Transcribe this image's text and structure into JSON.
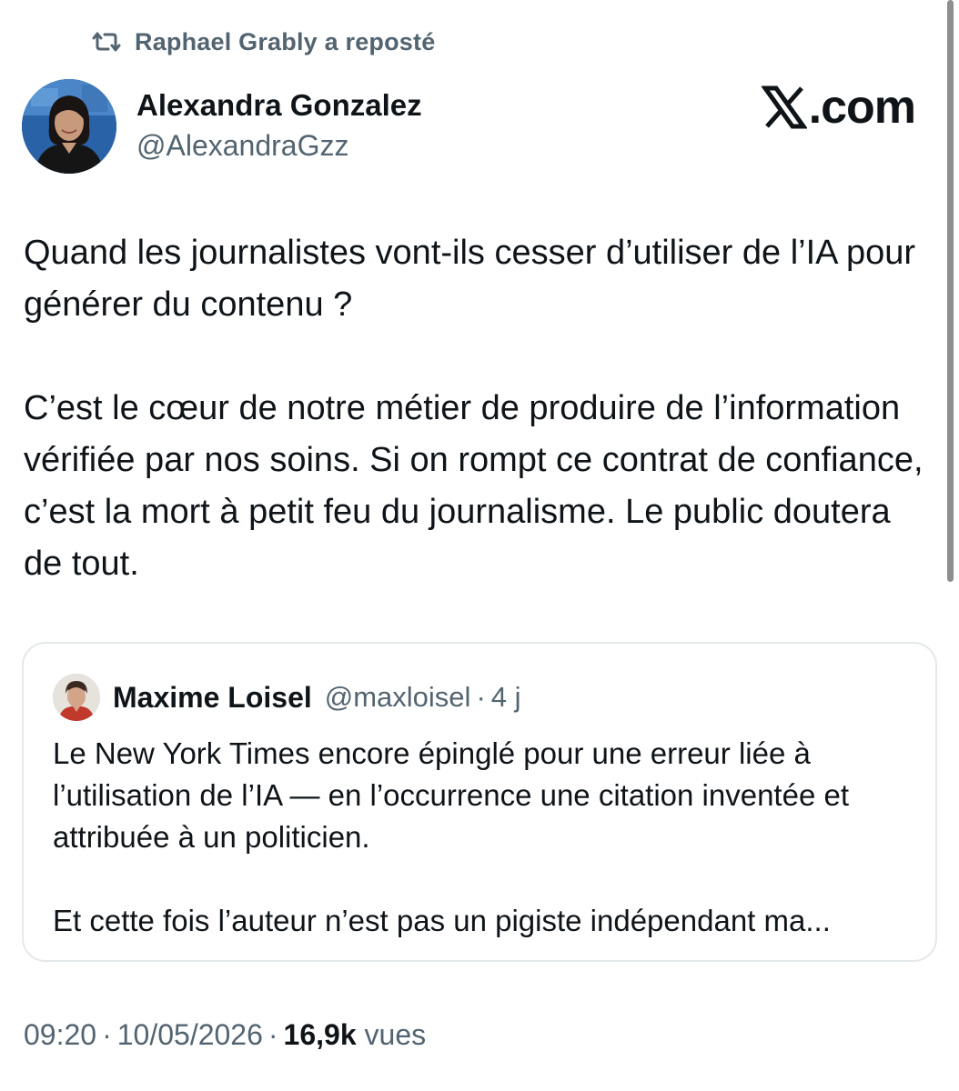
{
  "repost": {
    "icon": "repost-icon",
    "text": "Raphael Grably a reposté"
  },
  "author": {
    "name": "Alexandra Gonzalez",
    "handle": "@AlexandraGzz",
    "avatar": "author-avatar-photo"
  },
  "site_mark": {
    "logo": "x-logo-icon",
    "suffix": ".com"
  },
  "tweet": {
    "paragraphs": [
      "Quand les journalistes vont-ils cesser d’utiliser de l’IA pour générer du contenu ?",
      "C’est le cœur de notre métier de produire de l’information vérifiée par nos soins. Si on rompt ce contrat de confiance, c’est la mort à petit feu du journalisme. Le public doutera de tout."
    ]
  },
  "quote": {
    "author_name": "Maxime Loisel",
    "handle": "@maxloisel",
    "separator": "·",
    "time": "4 j",
    "paragraphs": [
      "Le New York Times encore épinglé pour une erreur liée à l’utilisation de l’IA — en l’occurrence une citation inventée et attribuée à un politicien.",
      "Et cette fois l’auteur n’est pas un pigiste indépendant ma..."
    ]
  },
  "meta": {
    "time": "09:20",
    "date": "10/05/2026",
    "separator": "·",
    "views_count": "16,9k",
    "views_label": "vues"
  },
  "colors": {
    "text": "#0f1419",
    "secondary": "#536471",
    "border": "#e4e8eb"
  }
}
